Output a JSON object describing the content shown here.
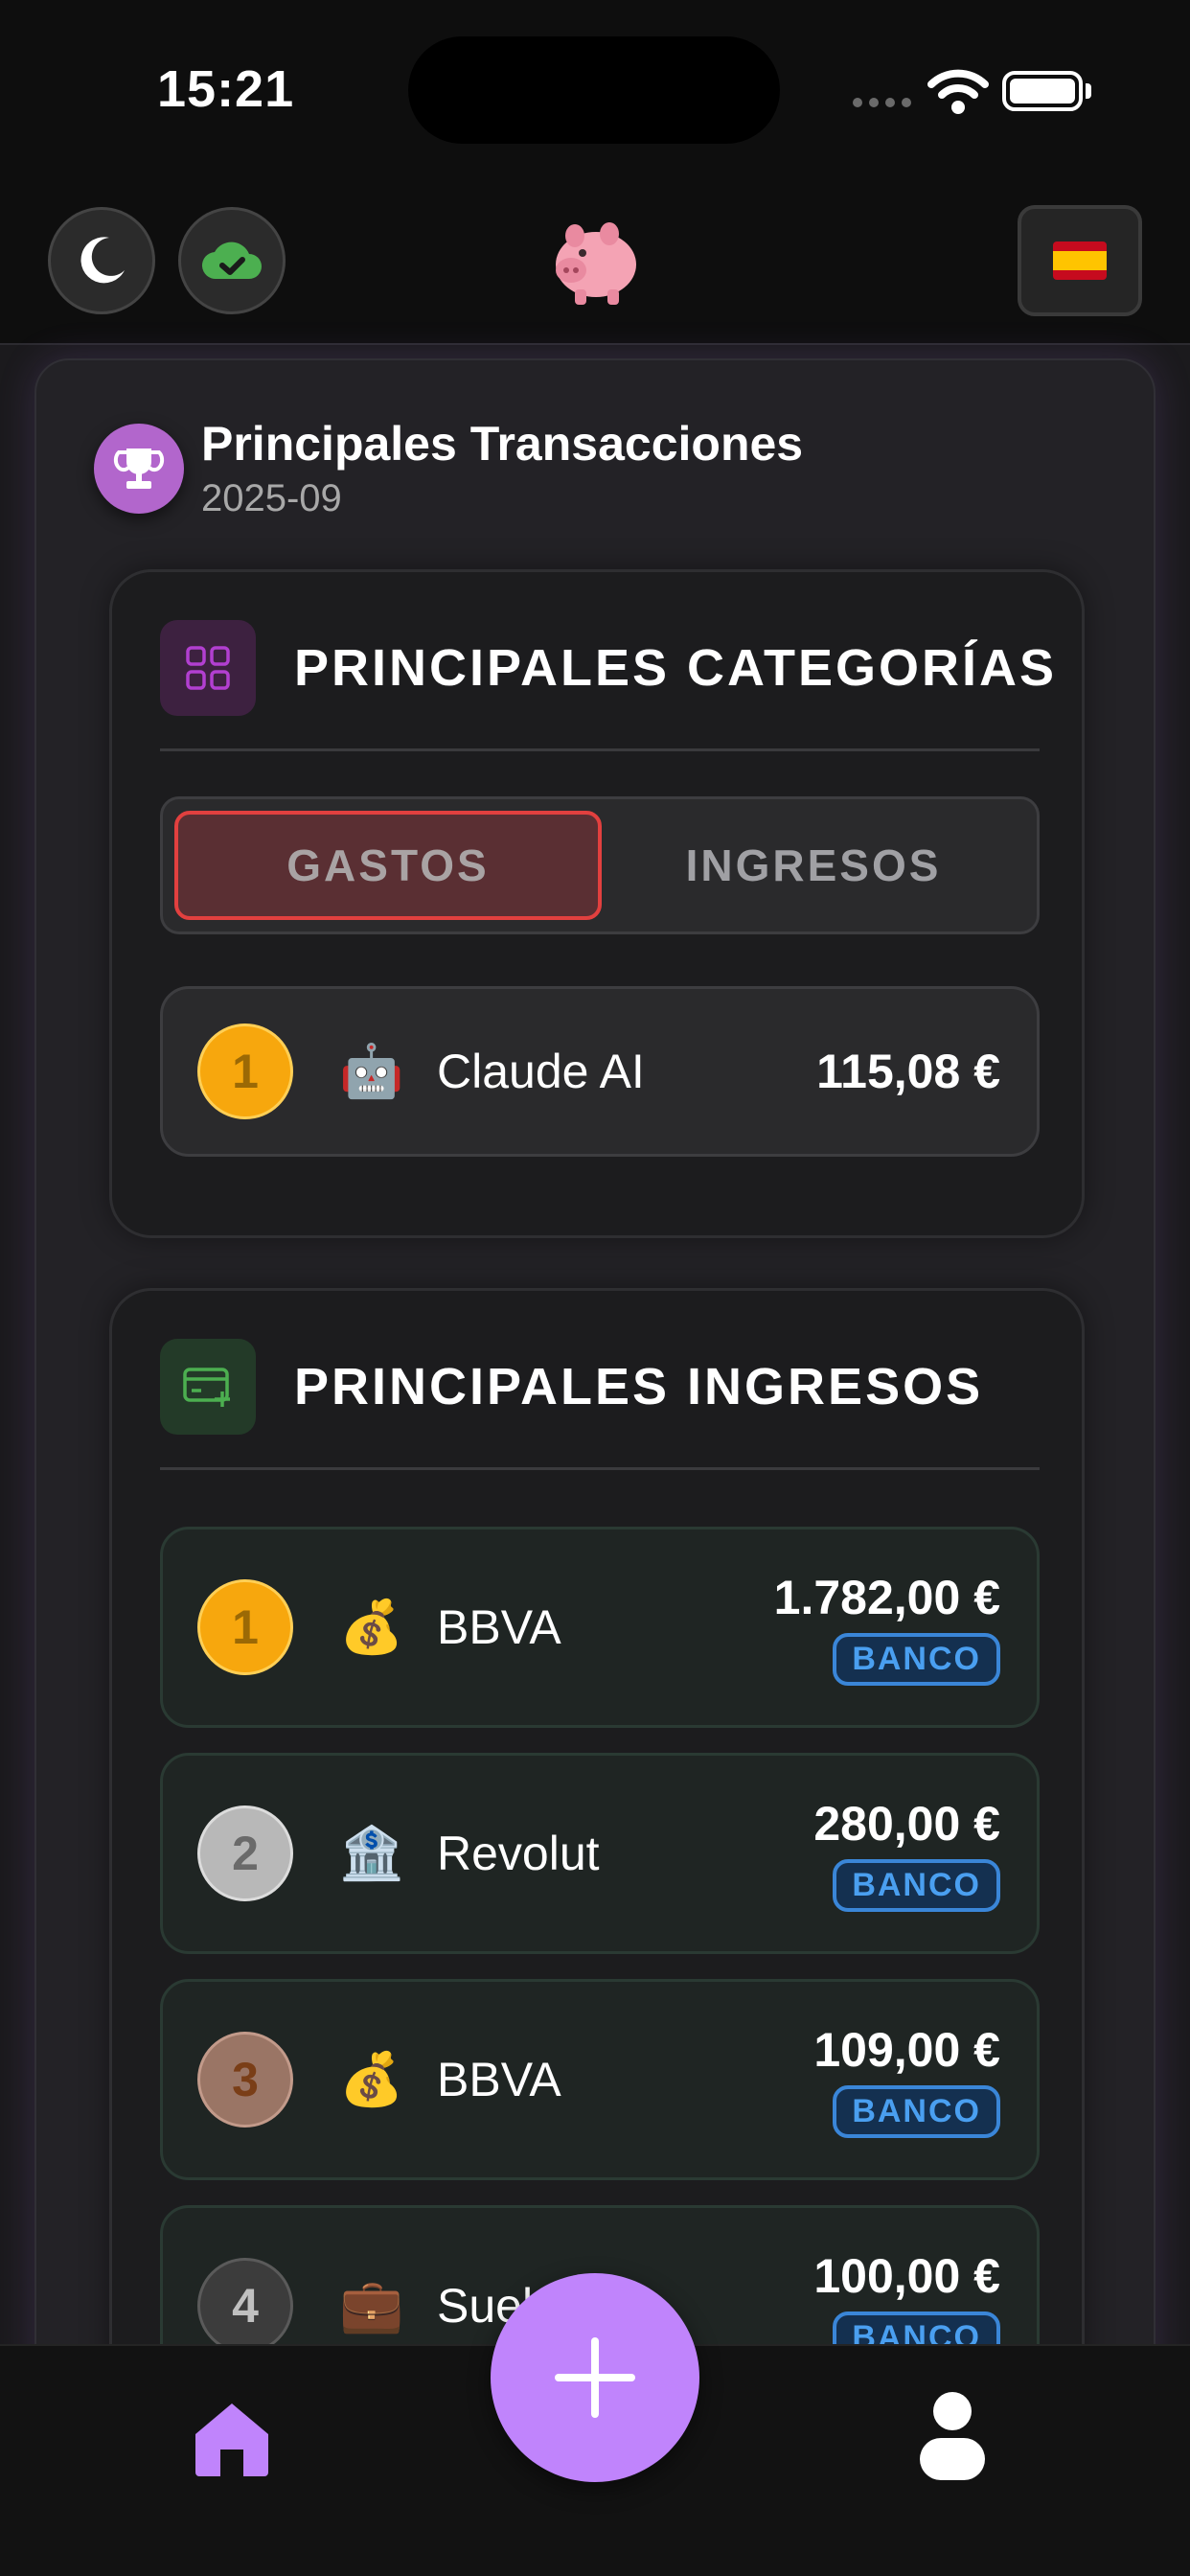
{
  "status_bar": {
    "time": "15:21"
  },
  "header": {
    "theme_icon": "moon-icon",
    "sync_icon": "cloud-check-icon",
    "logo_icon": "piggy-bank-icon",
    "language_icon": "spain-flag-icon"
  },
  "card": {
    "title": "Principales Transacciones",
    "period": "2025-09",
    "icon": "trophy-icon"
  },
  "categories": {
    "title": "PRINCIPALES CATEGORÍAS",
    "icon": "grid-icon",
    "tabs": [
      {
        "label": "GASTOS",
        "active": true
      },
      {
        "label": "INGRESOS",
        "active": false
      }
    ],
    "items": [
      {
        "rank": "1",
        "emoji": "🤖",
        "name": "Claude AI",
        "amount": "115,08 €"
      }
    ]
  },
  "incomes": {
    "title": "PRINCIPALES INGRESOS",
    "icon": "card-add-icon",
    "items": [
      {
        "rank": "1",
        "emoji": "💰",
        "name": "BBVA",
        "amount": "1.782,00 €",
        "badge": "BANCO"
      },
      {
        "rank": "2",
        "emoji": "🏦",
        "name": "Revolut",
        "amount": "280,00 €",
        "badge": "BANCO"
      },
      {
        "rank": "3",
        "emoji": "💰",
        "name": "BBVA",
        "amount": "109,00 €",
        "badge": "BANCO"
      },
      {
        "rank": "4",
        "emoji": "💼",
        "name": "Sueldo",
        "amount": "100,00 €",
        "badge": "BANCO"
      }
    ]
  },
  "nav": {
    "home_icon": "home-icon",
    "add_icon": "plus-icon",
    "profile_icon": "user-icon"
  },
  "colors": {
    "accent": "#c084fc",
    "expense_active": "#e2403f",
    "badge": "#3a86d8",
    "gold": "#f7a70d"
  }
}
